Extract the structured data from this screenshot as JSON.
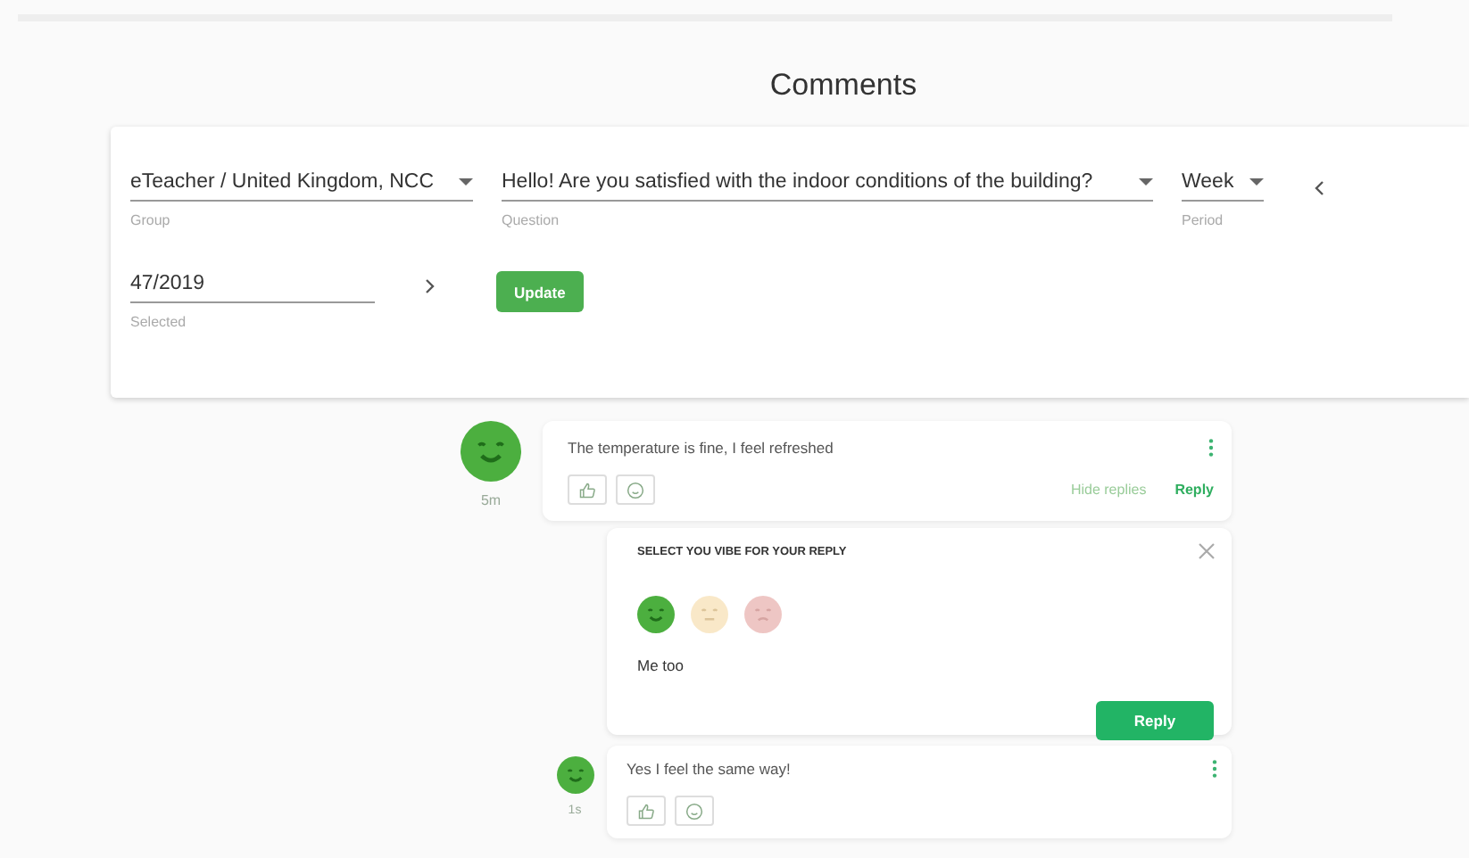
{
  "title": "Comments",
  "filters": {
    "fields": [
      {
        "value": "eTeacher / United Kingdom, NCC",
        "label": "Group",
        "dropdown": true
      },
      {
        "value": "Hello! Are you satisfied with the indoor conditions of the building?",
        "label": "Question",
        "dropdown": true
      },
      {
        "value": "Week",
        "label": "Period",
        "dropdown": true
      },
      {
        "value": "47/2019",
        "label": "Selected",
        "dropdown": false
      }
    ],
    "update_button": "Update"
  },
  "comment": {
    "kind": "good",
    "time": "5m",
    "text": "The temperature is fine, I feel refreshed",
    "hide_replies": "Hide replies",
    "reply": "Reply"
  },
  "reply_box": {
    "heading": "SELECT YOU VIBE FOR YOUR REPLY",
    "vibes": [
      {
        "kind": "good",
        "selected": true
      },
      {
        "kind": "neutral",
        "selected": false
      },
      {
        "kind": "bad",
        "selected": false
      }
    ],
    "value": "Me too",
    "submit": "Reply"
  },
  "replies": [
    {
      "kind": "good",
      "time": "1s",
      "text": "Yes I feel the same way!"
    }
  ]
}
